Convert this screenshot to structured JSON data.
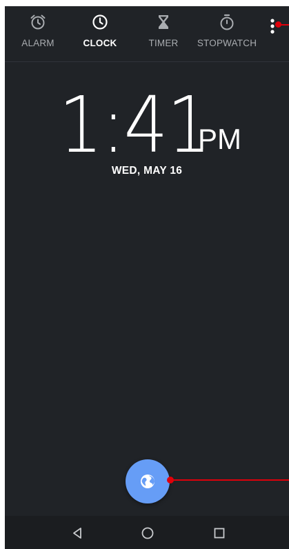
{
  "tabs": [
    {
      "label": "ALARM",
      "icon": "alarm-icon",
      "active": false
    },
    {
      "label": "CLOCK",
      "icon": "clock-icon",
      "active": true
    },
    {
      "label": "TIMER",
      "icon": "hourglass-icon",
      "active": false
    },
    {
      "label": "STOPWATCH",
      "icon": "stopwatch-icon",
      "active": false
    }
  ],
  "overflow_menu": {
    "icon": "more-vert-icon"
  },
  "clock": {
    "time": "1:41",
    "ampm": "PM",
    "date": "WED, MAY 16"
  },
  "fab": {
    "icon": "globe-icon",
    "color": "#669df6"
  },
  "navbar": {
    "back": "back-icon",
    "home": "home-icon",
    "recents": "recents-icon"
  },
  "colors": {
    "background": "#202327",
    "active_text": "#ffffff",
    "inactive_text": "#a9acb0",
    "annotation": "#e0000a"
  }
}
